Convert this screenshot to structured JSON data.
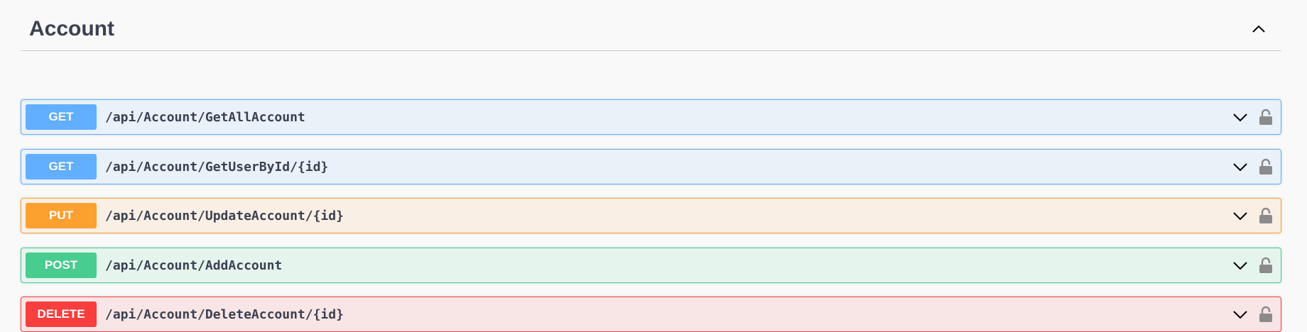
{
  "section": {
    "title": "Account"
  },
  "operations": [
    {
      "method": "GET",
      "path": "/api/Account/GetAllAccount"
    },
    {
      "method": "GET",
      "path": "/api/Account/GetUserById/{id}"
    },
    {
      "method": "PUT",
      "path": "/api/Account/UpdateAccount/{id}"
    },
    {
      "method": "POST",
      "path": "/api/Account/AddAccount"
    },
    {
      "method": "DELETE",
      "path": "/api/Account/DeleteAccount/{id}"
    }
  ],
  "icons": {
    "collapse": "chevron-up-icon",
    "expand": "chevron-down-icon",
    "auth": "lock-icon"
  },
  "colors": {
    "get": "#61affe",
    "put": "#fca130",
    "post": "#49cc90",
    "delete": "#f93e3e",
    "text": "#3b4151"
  }
}
